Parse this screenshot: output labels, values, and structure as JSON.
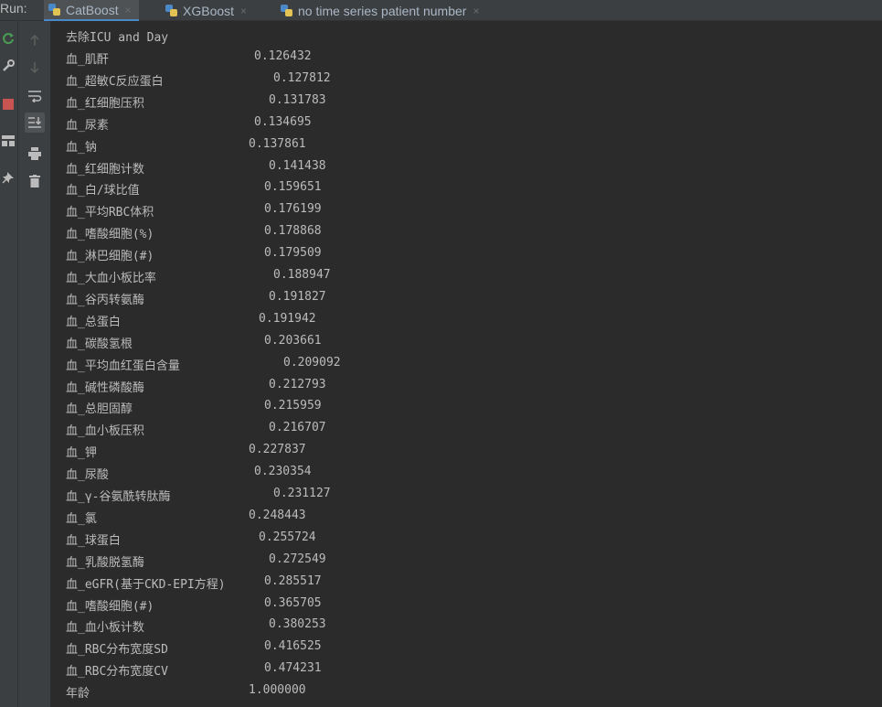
{
  "run_label": "Run:",
  "tabs": [
    {
      "label": "CatBoost",
      "active": true
    },
    {
      "label": "XGBoost",
      "active": false
    },
    {
      "label": "no time series patient number",
      "active": false
    }
  ],
  "close_glyph": "×",
  "console": {
    "title": "去除ICU and Day",
    "rows": [
      {
        "name": "血_肌酐",
        "value": "0.126432"
      },
      {
        "name": "血_超敏C反应蛋白",
        "value": "0.127812"
      },
      {
        "name": "血_红细胞压积",
        "value": "0.131783"
      },
      {
        "name": "血_尿素",
        "value": "0.134695"
      },
      {
        "name": "血_钠",
        "value": "0.137861"
      },
      {
        "name": "血_红细胞计数",
        "value": "0.141438"
      },
      {
        "name": "血_白/球比值",
        "value": "0.159651"
      },
      {
        "name": "血_平均RBC体积",
        "value": "0.176199"
      },
      {
        "name": "血_嗜酸细胞(%)",
        "value": "0.178868"
      },
      {
        "name": "血_淋巴细胞(#)",
        "value": "0.179509"
      },
      {
        "name": "血_大血小板比率",
        "value": "0.188947"
      },
      {
        "name": "血_谷丙转氨酶",
        "value": "0.191827"
      },
      {
        "name": "血_总蛋白",
        "value": "0.191942"
      },
      {
        "name": "血_碳酸氢根",
        "value": "0.203661"
      },
      {
        "name": "血_平均血红蛋白含量",
        "value": "0.209092"
      },
      {
        "name": "血_碱性磷酸酶",
        "value": "0.212793"
      },
      {
        "name": "血_总胆固醇",
        "value": "0.215959"
      },
      {
        "name": "血_血小板压积",
        "value": "0.216707"
      },
      {
        "name": "血_钾",
        "value": "0.227837"
      },
      {
        "name": "血_尿酸",
        "value": "0.230354"
      },
      {
        "name": "血_γ-谷氨酰转肽酶",
        "value": "0.231127"
      },
      {
        "name": "血_氯",
        "value": "0.248443"
      },
      {
        "name": "血_球蛋白",
        "value": "0.255724"
      },
      {
        "name": "血_乳酸脱氢酶",
        "value": "0.272549"
      },
      {
        "name": "血_eGFR(基于CKD-EPI方程)",
        "value": "0.285517"
      },
      {
        "name": "血_嗜酸细胞(#)",
        "value": "0.365705"
      },
      {
        "name": "血_血小板计数",
        "value": "0.380253"
      },
      {
        "name": "血_RBC分布宽度SD",
        "value": "0.416525"
      },
      {
        "name": "血_RBC分布宽度CV",
        "value": "0.474231"
      },
      {
        "name": "年龄",
        "value": "1.000000"
      }
    ]
  },
  "colors": {
    "console_bg": "#2b2b2b",
    "panel_bg": "#3c3f41",
    "console_text": "#bbbbbb",
    "tab_text": "#a9b7c6",
    "rerun_green": "#499c54",
    "stop_red": "#c75450"
  },
  "toolbar_icons": {
    "outer": [
      "rerun-icon",
      "wrench-icon",
      "stop-icon",
      "layout-icon",
      "pin-icon"
    ],
    "inner": [
      "up-arrow-icon",
      "down-arrow-icon",
      "soft-wrap-icon",
      "scroll-to-end-icon",
      "print-icon",
      "trash-icon"
    ]
  }
}
